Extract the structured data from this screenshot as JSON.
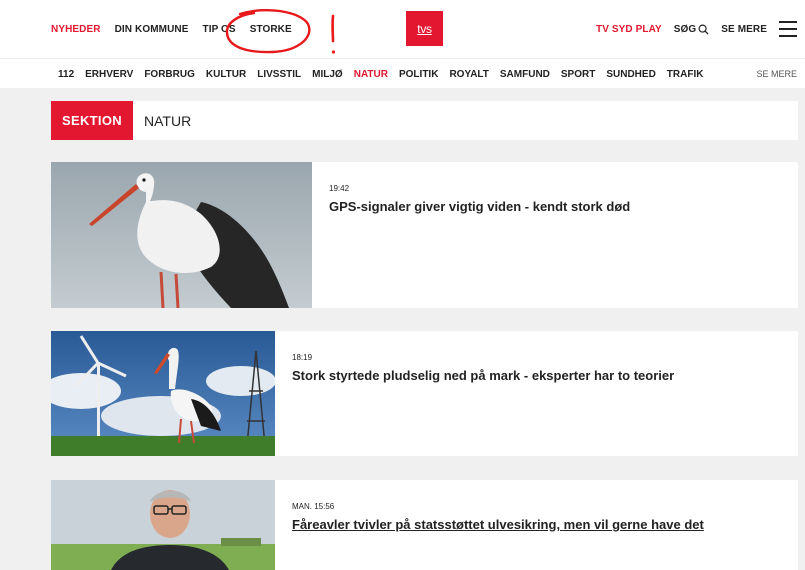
{
  "header": {
    "nav_left": [
      "NYHEDER",
      "DIN KOMMUNE",
      "TIP OS",
      "STORKE"
    ],
    "logo": "tvs",
    "nav_right": {
      "play": "TV SYD PLAY",
      "search": "SØG",
      "more": "SE MERE"
    }
  },
  "subnav": {
    "items": [
      "112",
      "ERHVERV",
      "FORBRUG",
      "KULTUR",
      "LIVSSTIL",
      "MILJØ",
      "NATUR",
      "POLITIK",
      "ROYALT",
      "SAMFUND",
      "SPORT",
      "SUNDHED",
      "TRAFIK"
    ],
    "active": "NATUR",
    "more": "SE MERE"
  },
  "section": {
    "tag": "SEKTION",
    "name": "NATUR"
  },
  "articles": [
    {
      "time": "19:42",
      "headline": "GPS-signaler giver vigtig viden - kendt stork død"
    },
    {
      "time": "18:19",
      "headline": "Stork styrtede pludselig ned på mark - eksperter har to teorier"
    },
    {
      "time": "MAN. 15:56",
      "headline": "Fåreavler tvivler på statsstøttet ulvesikring, men vil gerne have det"
    }
  ],
  "colors": {
    "brand_red": "#e3172f",
    "text": "#222222",
    "background": "#f0f0f0"
  },
  "icons": {
    "search": "search-icon",
    "menu": "hamburger-menu-icon"
  }
}
